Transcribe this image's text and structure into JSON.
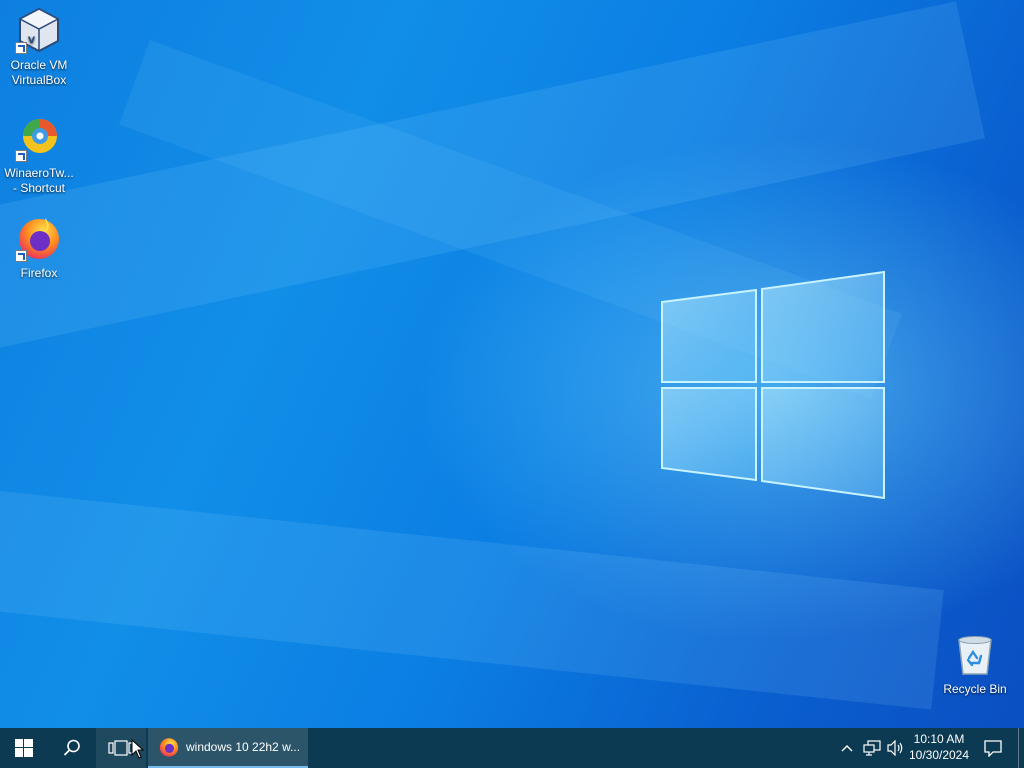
{
  "desktop": {
    "icons": [
      {
        "label_line1": "Oracle VM",
        "label_line2": "VirtualBox",
        "icon": "virtualbox-icon"
      },
      {
        "label_line1": "WinaeroTw...",
        "label_line2": "- Shortcut",
        "icon": "winaero-tweaker-icon"
      },
      {
        "label_line1": "Firefox",
        "icon": "firefox-icon"
      },
      {
        "label_line1": "Recycle Bin",
        "icon": "recycle-bin-icon"
      }
    ],
    "colors": {
      "accent": "#0b7ee3",
      "glow": "#78dcff"
    }
  },
  "taskbar": {
    "start": {
      "icon": "windows-start-icon"
    },
    "search": {
      "icon": "search-icon"
    },
    "task_view": {
      "icon": "task-view-icon"
    },
    "open_app": {
      "label": "windows 10 22h2 w...",
      "icon": "firefox-icon"
    },
    "tray": {
      "chevron_icon": "chevron-up-icon",
      "network_icon": "network-icon",
      "volume_icon": "volume-icon",
      "time": "10:10 AM",
      "date": "10/30/2024",
      "notification_icon": "action-center-icon"
    },
    "colors": {
      "background": "#0b3a52",
      "active_underline": "#76b9ed"
    }
  }
}
